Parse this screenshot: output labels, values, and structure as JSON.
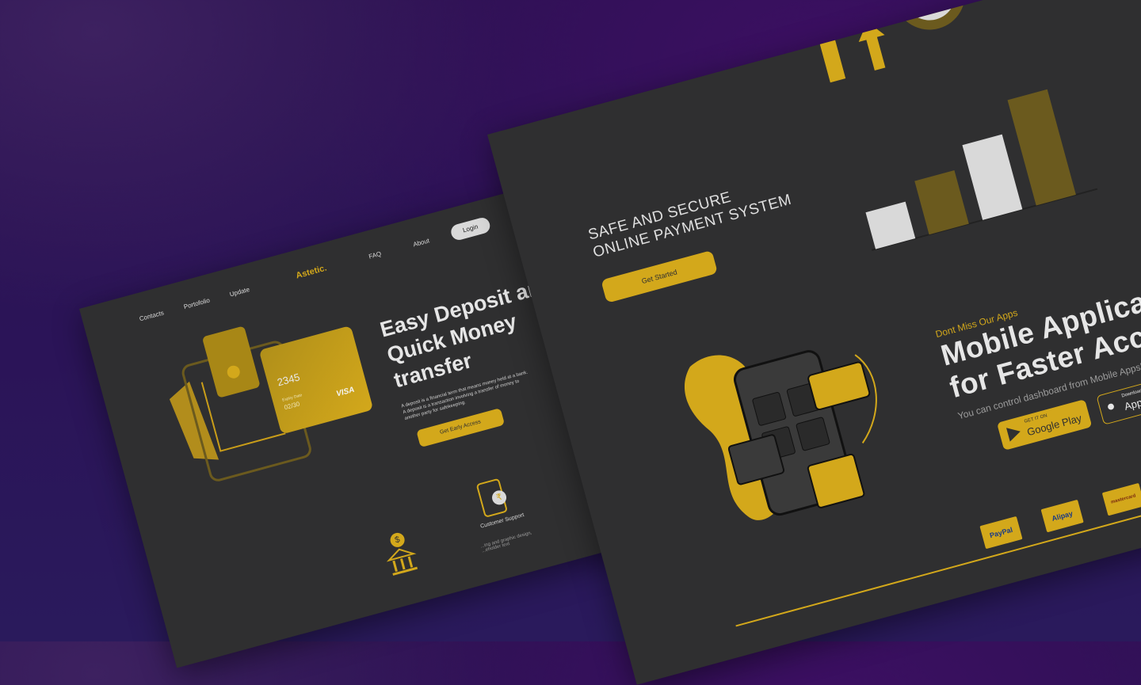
{
  "left": {
    "nav": {
      "contacts": "Contacts",
      "portfolio": "Portofolio",
      "update": "Update",
      "logo": "Astetic.",
      "faq": "FAQ",
      "about": "About",
      "login": "Login"
    },
    "hero": {
      "title": "Easy Deposit and Quick Money transfer",
      "description": "A deposit is a financial term that means money held at a bank. A deposit is a transaction involving a transfer of money to another party for safekeeping.",
      "cta": "Get Early Access"
    },
    "card": {
      "number_fragment": "2345",
      "expiry_label": "Expiry Date",
      "expiry": "02/30",
      "brand": "VISA"
    },
    "features": {
      "support_title": "Customer Support",
      "support_text": "...ing and graphic design, ...eholder text",
      "rupee_symbol": "₹",
      "dollar_symbol": "$"
    }
  },
  "right": {
    "hero": {
      "title_line1": "SAFE AND SECURE",
      "title_line2": "ONLINE PAYMENT SYSTEM",
      "cta": "Get Started"
    },
    "illustration": {
      "coin_symbol": "$"
    },
    "apps": {
      "eyebrow": "Dont Miss Our Apps",
      "title_line1": "Mobile Application",
      "title_line2": "for Faster Access",
      "subtitle": "You can control dashboard from Mobile Apps!",
      "google_play_small": "GET IT ON",
      "google_play_big": "Google Play",
      "app_store_small": "Download on the",
      "app_store_big": "App Store"
    },
    "payments": {
      "paypal": "PayPal",
      "alipay": "Alipay",
      "mastercard": "mastercard"
    }
  },
  "colors": {
    "accent": "#d3a81b",
    "panel": "#2f2f30",
    "bar_light": "#d9d9d9",
    "bar_dark": "#6b5a1e"
  },
  "icons": [
    "wallet-icon",
    "credit-card-icon",
    "bank-icon",
    "phone-support-icon",
    "arrow-up-icon",
    "dollar-coin-icon",
    "shopping-phone-illustration",
    "play-store-icon",
    "apple-icon"
  ]
}
